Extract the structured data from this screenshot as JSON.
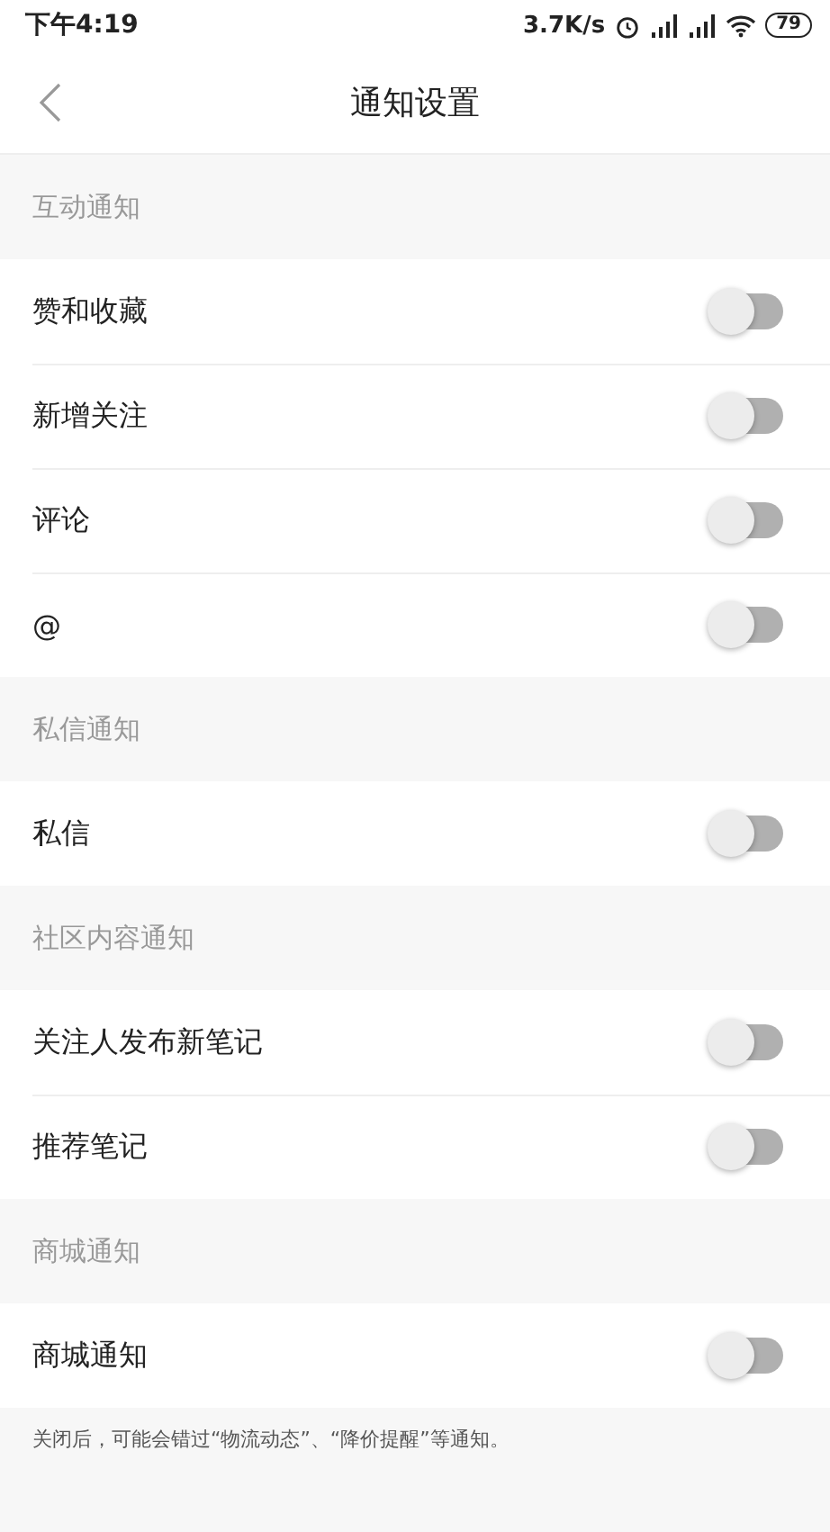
{
  "status_bar": {
    "time": "下午4:19",
    "speed": "3.7K/s",
    "battery": "79"
  },
  "header": {
    "title": "通知设置"
  },
  "sections": [
    {
      "title": "互动通知",
      "items": [
        {
          "label": "赞和收藏",
          "on": false
        },
        {
          "label": "新增关注",
          "on": false
        },
        {
          "label": "评论",
          "on": false
        },
        {
          "label": "@",
          "on": false
        }
      ]
    },
    {
      "title": "私信通知",
      "items": [
        {
          "label": "私信",
          "on": false
        }
      ]
    },
    {
      "title": "社区内容通知",
      "items": [
        {
          "label": "关注人发布新笔记",
          "on": false
        },
        {
          "label": "推荐笔记",
          "on": false
        }
      ]
    },
    {
      "title": "商城通知",
      "items": [
        {
          "label": "商城通知",
          "on": false
        }
      ]
    }
  ],
  "footnote": "关闭后，可能会错过“物流动态”、“降价提醒”等通知。"
}
